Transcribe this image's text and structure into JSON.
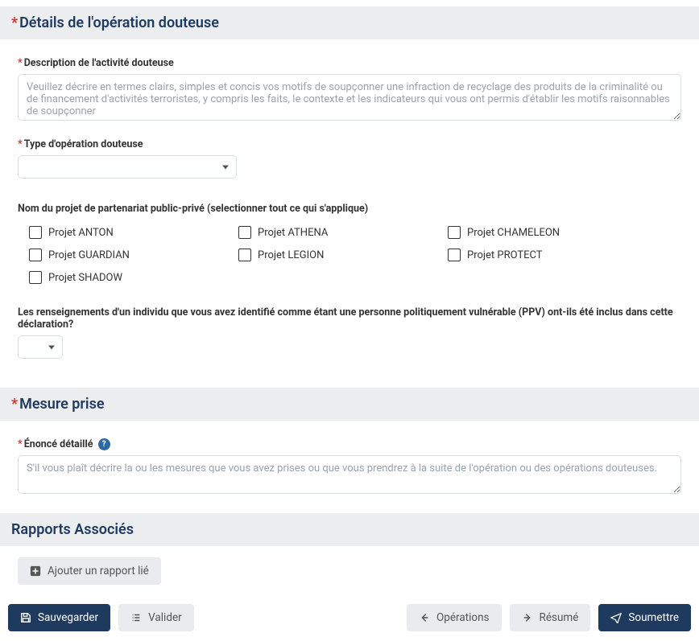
{
  "sections": {
    "details": {
      "title": "Détails de l'opération douteuse",
      "description": {
        "label": "Description de l'activité douteuse",
        "placeholder": "Veuillez décrire en termes clairs, simples et concis vos motifs de soupçonner une infraction de recyclage des produits de la criminalité ou de financement d'activités terroristes, y compris les faits, le contexte et les indicateurs qui vous ont permis d'établir les motifs raisonnables de soupçonner"
      },
      "type": {
        "label": "Type d'opération douteuse"
      },
      "project_group": {
        "label": "Nom du projet de partenariat public-privé (selectionner tout ce qui s'applique)",
        "options": [
          "Projet ANTON",
          "Projet ATHENA",
          "Projet CHAMELEON",
          "Projet GUARDIAN",
          "Projet LEGION",
          "Projet PROTECT",
          "Projet SHADOW"
        ]
      },
      "pep_question": "Les renseignements d'un individu que vous avez identifié comme étant une personne politiquement vulnérable (PPV) ont-ils été inclus dans cette déclaration?"
    },
    "action": {
      "title": "Mesure prise",
      "statement": {
        "label": "Énoncé détaillé",
        "placeholder": "S'il vous plaît décrire la ou les mesures que vous avez prises ou que vous prendrez à la suite de l'opération ou des opérations douteuses."
      }
    },
    "reports": {
      "title": "Rapports Associés",
      "add_button": "Ajouter un rapport lié"
    }
  },
  "footer": {
    "save": "Sauvegarder",
    "validate": "Valider",
    "operations": "Opérations",
    "summary": "Résumé",
    "submit": "Soumettre"
  }
}
